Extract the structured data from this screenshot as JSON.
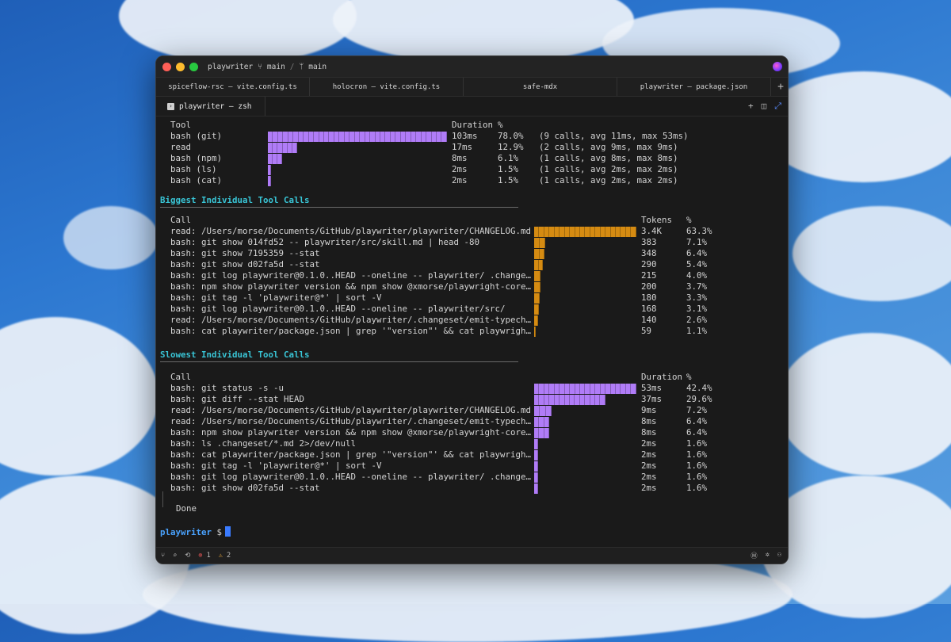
{
  "window": {
    "title": "playwriter",
    "branch1": "main",
    "branch2": "main",
    "tabs": [
      "spiceflow-rsc — vite.config.ts",
      "holocron — vite.config.ts",
      "safe-mdx",
      "playwriter — package.json"
    ],
    "add_tab": "+",
    "active_pane": "playwriter — zsh"
  },
  "duration_table": {
    "headers": [
      "Tool",
      "Duration",
      "%"
    ],
    "rows": [
      {
        "tool": "bash (git)",
        "duration": "103ms",
        "pct": "78.0%",
        "note": "(9 calls, avg 11ms, max 53ms)",
        "value": 103
      },
      {
        "tool": "read",
        "duration": "17ms",
        "pct": "12.9%",
        "note": "(2 calls, avg 9ms, max 9ms)",
        "value": 17
      },
      {
        "tool": "bash (npm)",
        "duration": "8ms",
        "pct": "6.1%",
        "note": "(1 calls, avg 8ms, max 8ms)",
        "value": 8
      },
      {
        "tool": "bash (ls)",
        "duration": "2ms",
        "pct": "1.5%",
        "note": "(1 calls, avg 2ms, max 2ms)",
        "value": 2
      },
      {
        "tool": "bash (cat)",
        "duration": "2ms",
        "pct": "1.5%",
        "note": "(1 calls, avg 2ms, max 2ms)",
        "value": 2
      }
    ]
  },
  "biggest": {
    "heading": "Biggest Individual Tool Calls",
    "headers": [
      "Call",
      "Tokens",
      "%"
    ],
    "rows": [
      {
        "call": "read: /Users/morse/Documents/GitHub/playwriter/playwriter/CHANGELOG.md",
        "tokens": "3.4K",
        "pct": "63.3%",
        "value": 63.3
      },
      {
        "call": "bash: git show 014fd52 -- playwriter/src/skill.md | head -80",
        "tokens": "383",
        "pct": "7.1%",
        "value": 7.1
      },
      {
        "call": "bash: git show 7195359 --stat",
        "tokens": "348",
        "pct": "6.4%",
        "value": 6.4
      },
      {
        "call": "bash: git show d02fa5d --stat",
        "tokens": "290",
        "pct": "5.4%",
        "value": 5.4
      },
      {
        "call": "bash: git log playwriter@0.1.0..HEAD --oneline -- playwriter/ .change…",
        "tokens": "215",
        "pct": "4.0%",
        "value": 4.0
      },
      {
        "call": "bash: npm show playwriter version && npm show @xmorse/playwright-core…",
        "tokens": "200",
        "pct": "3.7%",
        "value": 3.7
      },
      {
        "call": "bash: git tag -l 'playwriter@*' | sort -V",
        "tokens": "180",
        "pct": "3.3%",
        "value": 3.3
      },
      {
        "call": "bash: git log playwriter@0.1.0..HEAD --oneline -- playwriter/src/",
        "tokens": "168",
        "pct": "3.1%",
        "value": 3.1
      },
      {
        "call": "read: /Users/morse/Documents/GitHub/playwriter/.changeset/emit-typech…",
        "tokens": "140",
        "pct": "2.6%",
        "value": 2.6
      },
      {
        "call": "bash: cat playwriter/package.json | grep '\"version\"' && cat playwrigh…",
        "tokens": "59",
        "pct": "1.1%",
        "value": 1.1
      }
    ]
  },
  "slowest": {
    "heading": "Slowest Individual Tool Calls",
    "headers": [
      "Call",
      "Duration",
      "%"
    ],
    "rows": [
      {
        "call": "bash: git status -s -u",
        "duration": "53ms",
        "pct": "42.4%",
        "value": 42.4
      },
      {
        "call": "bash: git diff --stat HEAD",
        "duration": "37ms",
        "pct": "29.6%",
        "value": 29.6
      },
      {
        "call": "read: /Users/morse/Documents/GitHub/playwriter/playwriter/CHANGELOG.md",
        "duration": "9ms",
        "pct": "7.2%",
        "value": 7.2
      },
      {
        "call": "read: /Users/morse/Documents/GitHub/playwriter/.changeset/emit-typech…",
        "duration": "8ms",
        "pct": "6.4%",
        "value": 6.4
      },
      {
        "call": "bash: npm show playwriter version && npm show @xmorse/playwright-core…",
        "duration": "8ms",
        "pct": "6.4%",
        "value": 6.4
      },
      {
        "call": "bash: ls .changeset/*.md 2>/dev/null",
        "duration": "2ms",
        "pct": "1.6%",
        "value": 1.6
      },
      {
        "call": "bash: cat playwriter/package.json | grep '\"version\"' && cat playwrigh…",
        "duration": "2ms",
        "pct": "1.6%",
        "value": 1.6
      },
      {
        "call": "bash: git tag -l 'playwriter@*' | sort -V",
        "duration": "2ms",
        "pct": "1.6%",
        "value": 1.6
      },
      {
        "call": "bash: git log playwriter@0.1.0..HEAD --oneline -- playwriter/ .change…",
        "duration": "2ms",
        "pct": "1.6%",
        "value": 1.6
      },
      {
        "call": "bash: git show d02fa5d --stat",
        "duration": "2ms",
        "pct": "1.6%",
        "value": 1.6
      }
    ]
  },
  "done": "Done",
  "prompt": {
    "name": "playwriter",
    "symbol": "$"
  },
  "status": {
    "errors": "1",
    "warnings": "2"
  },
  "colors": {
    "purple": "#b07cf7",
    "orange": "#d58b12",
    "heading": "#39c5d6",
    "prompt": "#4aa3ff"
  }
}
